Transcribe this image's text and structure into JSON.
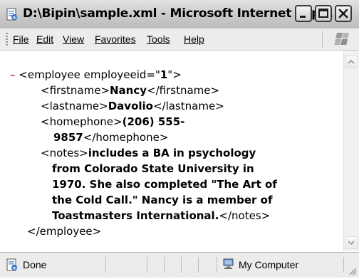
{
  "window": {
    "title": "D:\\Bipin\\sample.xml - Microsoft Internet Exp..."
  },
  "menu": {
    "items": [
      {
        "label": "File"
      },
      {
        "label": "Edit"
      },
      {
        "label": "View"
      },
      {
        "label": "Favorites"
      },
      {
        "label": "Tools"
      },
      {
        "label": "Help"
      }
    ]
  },
  "xml": {
    "collapse_marker": "–",
    "root_open_prefix": "<employee employeeid=\"",
    "root_attr_value": "1",
    "root_open_suffix": "\">",
    "firstname": {
      "open": "<firstname>",
      "value": "Nancy",
      "close": "</firstname>"
    },
    "lastname": {
      "open": "<lastname>",
      "value": "Davolio",
      "close": "</lastname>"
    },
    "homephone": {
      "open": "<homephone>",
      "value_line1": "(206) 555-",
      "value_line2": "9857",
      "close": "</homephone>"
    },
    "notes": {
      "open": "<notes>",
      "line1": "includes a BA in psychology",
      "line2": "from Colorado State University in",
      "line3": "1970. She also completed \"The Art of",
      "line4": "the Cold Call.\" Nancy is a member of",
      "line5": "Toastmasters International.",
      "close": "</notes>"
    },
    "root_close": "</employee>"
  },
  "status": {
    "left_text": "Done",
    "zone_text": "My Computer"
  },
  "icons": {
    "app": "ie-page-icon",
    "done": "page-done-icon",
    "zone": "computer-icon",
    "logo": "windows-logo-icon"
  }
}
